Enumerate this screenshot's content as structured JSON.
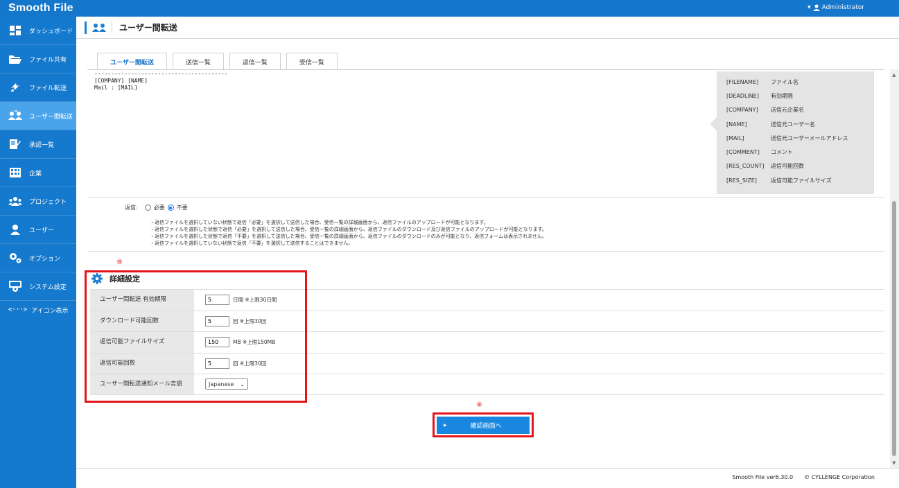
{
  "app": {
    "logo": "Smooth File",
    "user": "Administrator"
  },
  "sidebar": {
    "items": [
      {
        "label": "ダッシュボード",
        "icon": "dashboard-icon"
      },
      {
        "label": "ファイル共有",
        "icon": "folder-icon"
      },
      {
        "label": "ファイル転送",
        "icon": "transfer-icon"
      },
      {
        "label": "ユーザー間転送",
        "icon": "user-transfer-icon"
      },
      {
        "label": "承認一覧",
        "icon": "approval-icon"
      },
      {
        "label": "企業",
        "icon": "company-icon"
      },
      {
        "label": "プロジェクト",
        "icon": "project-icon"
      },
      {
        "label": "ユーザー",
        "icon": "user-icon"
      },
      {
        "label": "オプション",
        "icon": "options-icon"
      },
      {
        "label": "システム設定",
        "icon": "system-settings-icon"
      }
    ],
    "icon_toggle": {
      "glyph": "<···>",
      "label": "アイコン表示"
    }
  },
  "header": {
    "title": "ユーザー間転送"
  },
  "tabs": [
    "ユーザー間転送",
    "送信一覧",
    "返信一覧",
    "受信一覧"
  ],
  "template_text": {
    "divider": "----------------------------------------",
    "line1": "[COMPANY] [NAME]",
    "line2": "Mail : [MAIL]"
  },
  "variables": [
    {
      "key": "[FILENAME]",
      "desc": "ファイル名"
    },
    {
      "key": "[DEADLINE]",
      "desc": "有効期限"
    },
    {
      "key": "[COMPANY]",
      "desc": "送信元企業名"
    },
    {
      "key": "[NAME]",
      "desc": "送信元ユーザー名"
    },
    {
      "key": "[MAIL]",
      "desc": "送信元ユーザーメールアドレス"
    },
    {
      "key": "[COMMENT]",
      "desc": "コメント"
    },
    {
      "key": "[RES_COUNT]",
      "desc": "返信可能回数"
    },
    {
      "key": "[RES_SIZE]",
      "desc": "返信可能ファイルサイズ"
    }
  ],
  "reply": {
    "label": "返信:",
    "option_required": "必要",
    "option_not_required": "不要",
    "selected": "不要",
    "notes": [
      "・返信ファイルを選択していない状態で返信「必要」を選択して送信した場合、受信一覧の詳細画面から、返信ファイルのアップロードが可能となります。",
      "・返信ファイルを選択した状態で返信「必要」を選択して送信した場合、受信一覧の詳細画面から、返信ファイルのダウンロード及び返信ファイルのアップロードが可能となります。",
      "・返信ファイルを選択した状態で返信「不要」を選択して送信した場合、受信一覧の詳細画面から、返信ファイルのダウンロードのみが可能となり、返信フォームは表示されません。",
      "・返信ファイルを選択していない状態で返信「不要」を選択して送信することはできません。"
    ]
  },
  "markers": {
    "detail": "⑧",
    "confirm": "⑨"
  },
  "detail": {
    "title": "詳細設定",
    "rows": [
      {
        "label": "ユーザー間転送 有効期限",
        "value": "5",
        "suffix": "日間 ※上限30日間"
      },
      {
        "label": "ダウンロード可能回数",
        "value": "5",
        "suffix": "回 ※上限30回"
      },
      {
        "label": "返信可能ファイルサイズ",
        "value": "150",
        "suffix": "MB ※上限150MB"
      },
      {
        "label": "返信可能回数",
        "value": "5",
        "suffix": "回 ※上限30回"
      }
    ],
    "language": {
      "label": "ユーザー間転送通知メール言語",
      "selected": "Japanese"
    }
  },
  "confirm_button": "確認画面へ",
  "footer": {
    "version": "Smooth File ver6.30.0",
    "copyright": "© CYLLENGE Corporation"
  },
  "colors": {
    "primary": "#1477cc",
    "sidebar": "#1579cd",
    "active": "#4aa4ea",
    "highlight": "#e3141b"
  }
}
